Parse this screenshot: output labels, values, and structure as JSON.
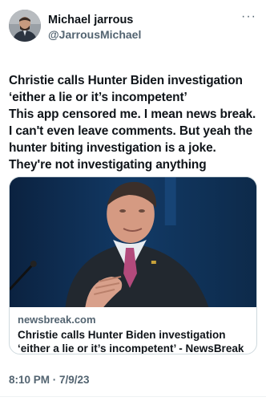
{
  "author": {
    "display_name": "Michael jarrous",
    "handle": "@JarrousMichael",
    "avatar_icon": "user-avatar"
  },
  "more_icon": "more-options-icon",
  "more_label": "···",
  "tweet": {
    "text": "Christie calls Hunter Biden investigation ‘either a lie or it’s incompetent’\nThis app censored me. I mean news break. I can't even leave comments. But yeah the hunter biting investigation is a joke. They're not investigating anything"
  },
  "link_card": {
    "domain": "newsbreak.com",
    "title": "Christie calls Hunter Biden investigation ‘either a lie or it’s incompetent’ - NewsBreak",
    "image_description_icon": "article-photo"
  },
  "timestamp": "8:10 PM · 7/9/23",
  "colors": {
    "text_primary": "#0f1419",
    "text_secondary": "#536471",
    "border": "#cfd9de",
    "photo_background": "#0d2a4a",
    "suit": "#22282f",
    "tie": "#b34a7c"
  }
}
